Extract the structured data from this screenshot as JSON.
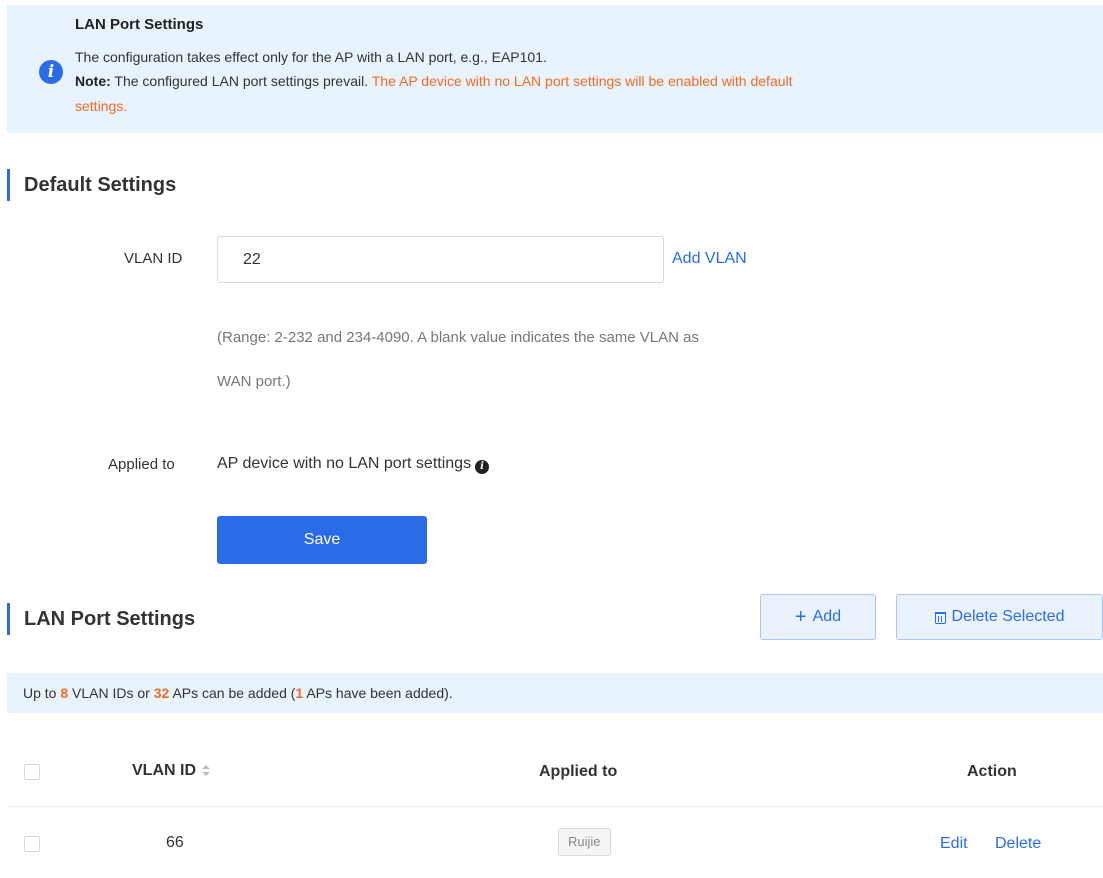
{
  "notice": {
    "title": "LAN Port Settings",
    "line1": "The configuration takes effect only for the AP with a LAN port, e.g., EAP101.",
    "note_label": "Note:",
    "note_text": " The configured LAN port settings prevail. ",
    "note_warning_a": "The AP device with no LAN port settings will be enabled with default",
    "note_warning_b": "settings.",
    "icon": "info-icon"
  },
  "default_settings": {
    "title": "Default Settings",
    "vlan_label": "VLAN ID",
    "vlan_value": "22",
    "add_vlan_link": "Add VLAN",
    "hint_line1": "(Range: 2-232 and 234-4090. A blank value indicates the same VLAN as",
    "hint_line2": "WAN port.)",
    "applied_label": "Applied to",
    "applied_value": "AP device with no LAN port settings",
    "save_label": "Save"
  },
  "lan_port_settings": {
    "title": "LAN Port Settings",
    "add_label": "Add",
    "delete_selected_label": "Delete Selected",
    "limit": {
      "prefix": "Up to ",
      "vlan_max": "8",
      "mid1": "  VLAN IDs or ",
      "ap_max": "32",
      "mid2": "  APs can be added (",
      "ap_count": "1",
      "suffix": "  APs have been added)."
    },
    "columns": {
      "vlan_id": "VLAN ID",
      "applied_to": "Applied to",
      "action": "Action"
    },
    "rows": [
      {
        "vlan_id": "66",
        "applied_to": "Ruijie",
        "edit_label": "Edit",
        "delete_label": "Delete"
      }
    ]
  },
  "colors": {
    "accent": "#2b6de8",
    "warning": "#f36b21",
    "notice_bg": "#e8f3fd"
  }
}
